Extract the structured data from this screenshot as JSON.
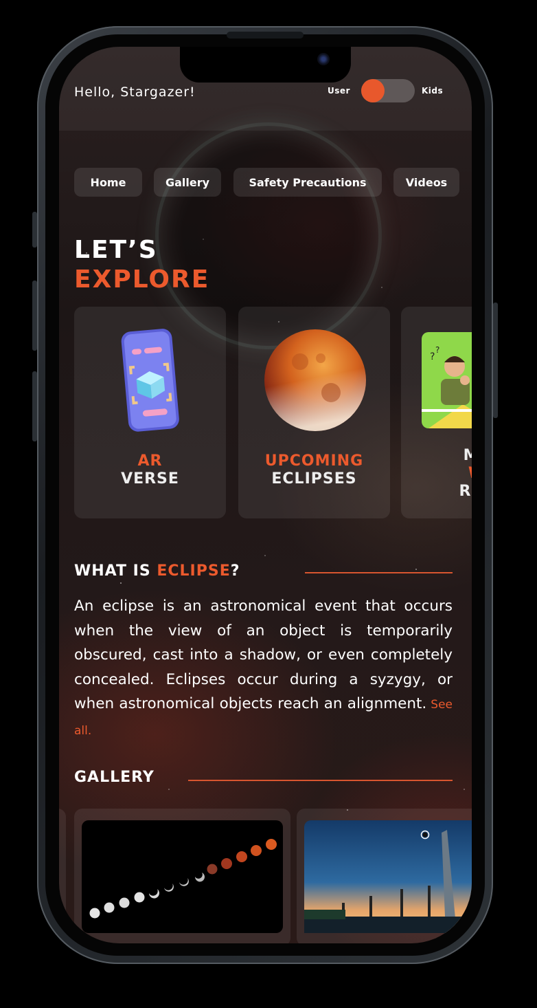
{
  "header": {
    "greeting": "Hello, Stargazer!",
    "mode_user": "User",
    "mode_kids": "Kids",
    "mode_toggle_on": false
  },
  "nav": {
    "items": [
      {
        "label": "Home"
      },
      {
        "label": "Gallery"
      },
      {
        "label": "Safety Precautions"
      },
      {
        "label": "Videos"
      }
    ]
  },
  "explore": {
    "title_line1": "LET’S",
    "title_line2": "EXPLORE",
    "cards": [
      {
        "line1": "AR",
        "line2": "VERSE",
        "icon": "ar-phone-icon"
      },
      {
        "line1": "UPCOMING",
        "line2": "ECLIPSES",
        "icon": "blood-moon-icon"
      },
      {
        "line1": "MY",
        "line2": "W",
        "line3": "REA",
        "icon": "thinking-boy-icon"
      }
    ]
  },
  "about": {
    "title_prefix": "WHAT IS ",
    "title_accent": "ECLIPSE",
    "title_suffix": "?",
    "text": "An eclipse is an astronomical event that occurs when the view of an object is temporarily obscured, cast into a shadow, or even completely concealed. Eclipses occur during a syzygy, or when astronomical objects reach an alignment.",
    "see_all": "See all."
  },
  "gallery": {
    "title": "GALLERY",
    "items": [
      {
        "icon": "lunar-eclipse-sequence-image"
      },
      {
        "icon": "solar-eclipse-stadium-image"
      }
    ]
  },
  "colors": {
    "accent": "#ec5a2d",
    "text": "#ffffff",
    "card": "rgba(255,255,255,0.08)"
  }
}
